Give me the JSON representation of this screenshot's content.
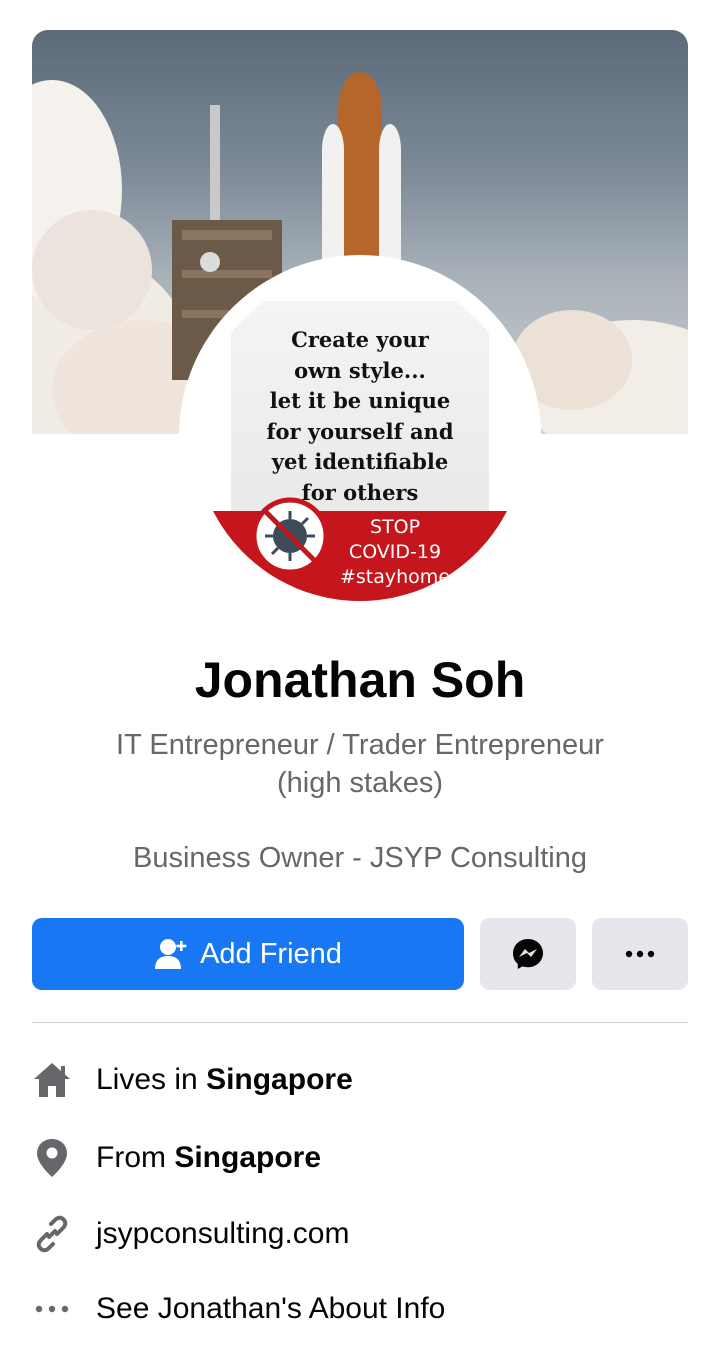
{
  "profile": {
    "name": "Jonathan Soh",
    "bio": "IT Entrepreneur / Trader Entrepreneur (high stakes)",
    "work": "Business Owner - JSYP Consulting"
  },
  "avatar_image": {
    "quote": "Create your\nown style...\nlet it be unique\nfor yourself and\nyet identifiable\nfor others",
    "badge_text": "STOP\nCOVID-19\n#stayhome"
  },
  "actions": {
    "add_friend_label": "Add Friend",
    "messenger_icon": "messenger-icon",
    "more_icon": "more-icon"
  },
  "info": {
    "lives_prefix": "Lives in ",
    "lives_city": "Singapore",
    "from_prefix": "From ",
    "from_city": "Singapore",
    "website": "jsypconsulting.com",
    "about_link": "See Jonathan's About Info"
  },
  "colors": {
    "primary": "#1877f2",
    "secondary_button": "#e4e6eb",
    "secondary_text": "#65676b",
    "covid_red": "#c4161c"
  }
}
